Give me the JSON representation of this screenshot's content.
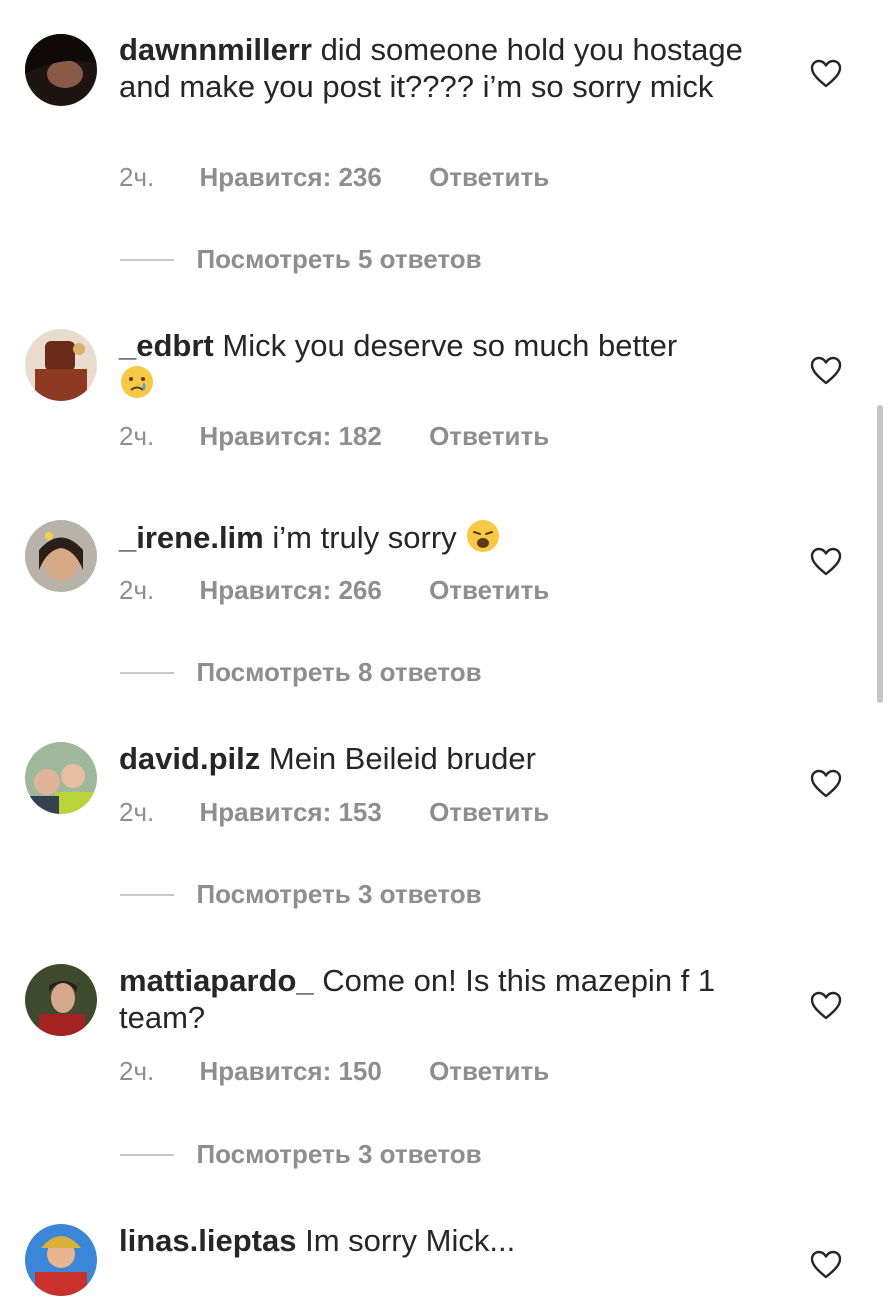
{
  "comments": [
    {
      "username": "dawnnmillerr",
      "text": "did someone hold you hostage and make you post it???? i’m so sorry mick",
      "time": "2ч.",
      "likes": "Нравится: 236",
      "reply": "Ответить",
      "replies": "Посмотреть 5 ответов",
      "avatar_color": "#2a1b16"
    },
    {
      "username": "_edbrt",
      "text": "Mick you deserve so much better",
      "emoji": "crying-face-emoji",
      "time": "2ч.",
      "likes": "Нравится: 182",
      "reply": "Ответить",
      "avatar_color": "#7a2f1c"
    },
    {
      "username": "_irene.lim",
      "text": "i’m truly sorry",
      "emoji": "weary-face-emoji",
      "time": "2ч.",
      "likes": "Нравится: 266",
      "reply": "Ответить",
      "replies": "Посмотреть 8 ответов",
      "avatar_color": "#3b2d25"
    },
    {
      "username": "david.pilz",
      "text": "Mein Beileid bruder",
      "time": "2ч.",
      "likes": "Нравится: 153",
      "reply": "Ответить",
      "replies": "Посмотреть 3 ответов",
      "avatar_color": "#6c8a4a"
    },
    {
      "username": "mattiapardo_",
      "text": "Come on! Is this mazepin f 1 team?",
      "time": "2ч.",
      "likes": "Нравится: 150",
      "reply": "Ответить",
      "replies": "Посмотреть 3 ответов",
      "avatar_color": "#33402a"
    },
    {
      "username": "linas.lieptas",
      "text": "Im sorry Mick...",
      "avatar_color": "#2e78c8"
    }
  ],
  "colors": {
    "primary_text": "#262626",
    "secondary_text": "#8e8e8e",
    "divider": "#c7c7c7"
  }
}
